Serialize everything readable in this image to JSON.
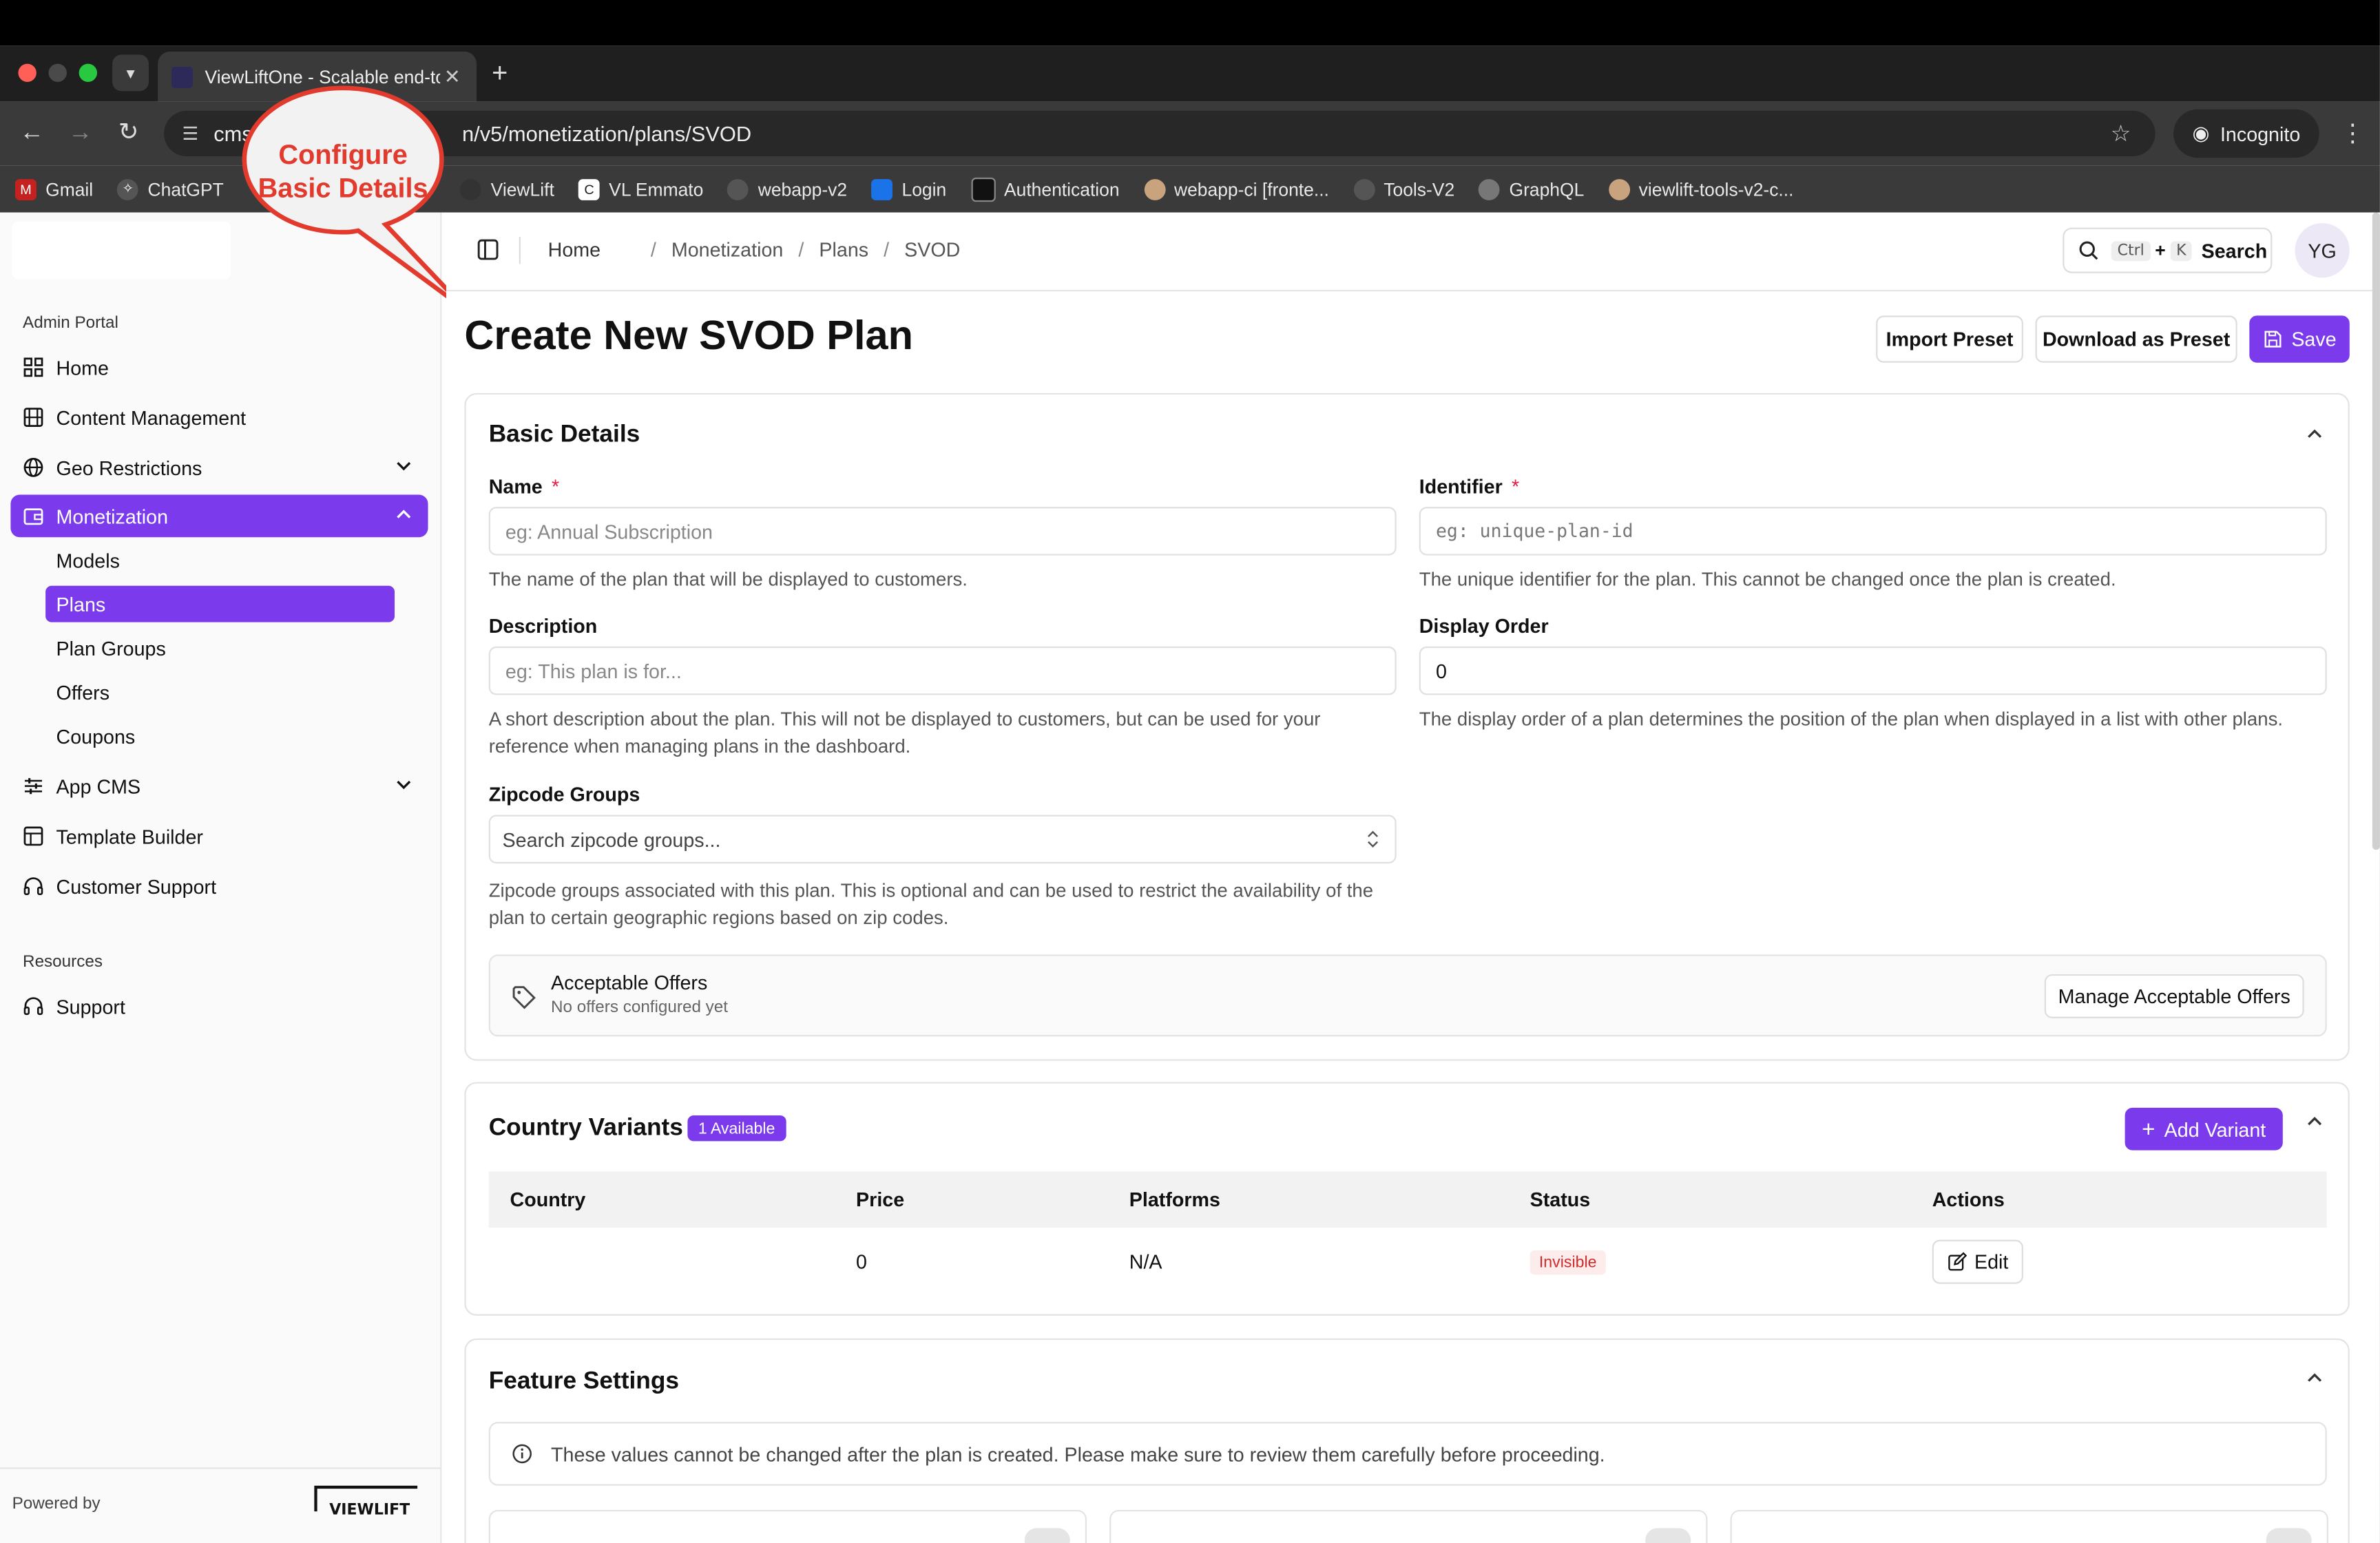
{
  "browser": {
    "tab_title": "ViewLiftOne - Scalable end-to",
    "url_visible_start": "cms",
    "url_visible_end": "n/v5/monetization/plans/SVOD",
    "incognito_label": "Incognito",
    "bookmarks": [
      "Gmail",
      "ChatGPT",
      "ViewLift",
      "VL Emmato",
      "webapp-v2",
      "Login",
      "Authentication",
      "webapp-ci [fronte...",
      "Tools-V2",
      "GraphQL",
      "viewlift-tools-v2-c..."
    ]
  },
  "callout": {
    "line1": "Configure",
    "line2": "Basic Details"
  },
  "sidebar": {
    "group_admin": "Admin Portal",
    "items": {
      "home": "Home",
      "content": "Content Management",
      "geo": "Geo Restrictions",
      "monetization": "Monetization",
      "appcms": "App CMS",
      "template": "Template Builder",
      "support_cust": "Customer Support"
    },
    "subitems": {
      "models": "Models",
      "plans": "Plans",
      "plan_groups": "Plan Groups",
      "offers": "Offers",
      "coupons": "Coupons"
    },
    "group_resources": "Resources",
    "support": "Support",
    "powered_by": "Powered by",
    "brand": "VIEWLIFT"
  },
  "header": {
    "breadcrumbs": [
      "Home",
      "Monetization",
      "Plans",
      "SVOD"
    ],
    "search_kbd1": "Ctrl",
    "search_plus": "+",
    "search_kbd2": "K",
    "search_label": "Search",
    "avatar": "YG"
  },
  "page": {
    "title": "Create New SVOD Plan",
    "import_btn": "Import Preset",
    "download_btn": "Download as Preset",
    "save_btn": "Save"
  },
  "basic": {
    "title": "Basic Details",
    "name_label": "Name",
    "name_placeholder": "eg: Annual Subscription",
    "name_help": "The name of the plan that will be displayed to customers.",
    "id_label": "Identifier",
    "id_placeholder": "eg: unique-plan-id",
    "id_help": "The unique identifier for the plan. This cannot be changed once the plan is created.",
    "desc_label": "Description",
    "desc_placeholder": "eg: This plan is for...",
    "desc_help": "A short description about the plan. This will not be displayed to customers, but can be used for your reference when managing plans in the dashboard.",
    "order_label": "Display Order",
    "order_value": "0",
    "order_help": "The display order of a plan determines the position of the plan when displayed in a list with other plans.",
    "zip_label": "Zipcode Groups",
    "zip_placeholder": "Search zipcode groups...",
    "zip_help": "Zipcode groups associated with this plan. This is optional and can be used to restrict the availability of the plan to certain geographic regions based on zip codes.",
    "offers_title": "Acceptable Offers",
    "offers_sub": "No offers configured yet",
    "offers_btn": "Manage Acceptable Offers",
    "required_mark": "*"
  },
  "variants": {
    "title": "Country Variants",
    "badge": "1 Available",
    "add_btn": "Add Variant",
    "columns": [
      "Country",
      "Price",
      "Platforms",
      "Status",
      "Actions"
    ],
    "row": {
      "country": "",
      "price": "0",
      "platforms": "N/A",
      "status": "Invisible",
      "action": "Edit"
    }
  },
  "features": {
    "title": "Feature Settings",
    "notice": "These values cannot be changed after the plan is created. Please make sure to review them carefully before proceeding."
  },
  "colors": {
    "accent": "#7c3aed",
    "callout": "#e23b2e",
    "status_bg": "#fdecec",
    "status_fg": "#d12c2c"
  }
}
